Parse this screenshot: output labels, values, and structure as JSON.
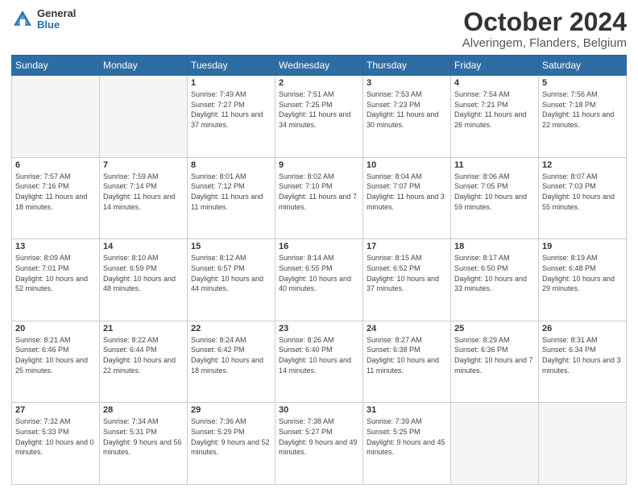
{
  "header": {
    "logo_line1": "General",
    "logo_line2": "Blue",
    "title": "October 2024",
    "subtitle": "Alveringem, Flanders, Belgium"
  },
  "days_of_week": [
    "Sunday",
    "Monday",
    "Tuesday",
    "Wednesday",
    "Thursday",
    "Friday",
    "Saturday"
  ],
  "weeks": [
    [
      {
        "day": "",
        "sunrise": "",
        "sunset": "",
        "daylight": "",
        "empty": true
      },
      {
        "day": "",
        "sunrise": "",
        "sunset": "",
        "daylight": "",
        "empty": true
      },
      {
        "day": "1",
        "sunrise": "Sunrise: 7:49 AM",
        "sunset": "Sunset: 7:27 PM",
        "daylight": "Daylight: 11 hours and 37 minutes.",
        "empty": false
      },
      {
        "day": "2",
        "sunrise": "Sunrise: 7:51 AM",
        "sunset": "Sunset: 7:25 PM",
        "daylight": "Daylight: 11 hours and 34 minutes.",
        "empty": false
      },
      {
        "day": "3",
        "sunrise": "Sunrise: 7:53 AM",
        "sunset": "Sunset: 7:23 PM",
        "daylight": "Daylight: 11 hours and 30 minutes.",
        "empty": false
      },
      {
        "day": "4",
        "sunrise": "Sunrise: 7:54 AM",
        "sunset": "Sunset: 7:21 PM",
        "daylight": "Daylight: 11 hours and 26 minutes.",
        "empty": false
      },
      {
        "day": "5",
        "sunrise": "Sunrise: 7:56 AM",
        "sunset": "Sunset: 7:18 PM",
        "daylight": "Daylight: 11 hours and 22 minutes.",
        "empty": false
      }
    ],
    [
      {
        "day": "6",
        "sunrise": "Sunrise: 7:57 AM",
        "sunset": "Sunset: 7:16 PM",
        "daylight": "Daylight: 11 hours and 18 minutes.",
        "empty": false
      },
      {
        "day": "7",
        "sunrise": "Sunrise: 7:59 AM",
        "sunset": "Sunset: 7:14 PM",
        "daylight": "Daylight: 11 hours and 14 minutes.",
        "empty": false
      },
      {
        "day": "8",
        "sunrise": "Sunrise: 8:01 AM",
        "sunset": "Sunset: 7:12 PM",
        "daylight": "Daylight: 11 hours and 11 minutes.",
        "empty": false
      },
      {
        "day": "9",
        "sunrise": "Sunrise: 8:02 AM",
        "sunset": "Sunset: 7:10 PM",
        "daylight": "Daylight: 11 hours and 7 minutes.",
        "empty": false
      },
      {
        "day": "10",
        "sunrise": "Sunrise: 8:04 AM",
        "sunset": "Sunset: 7:07 PM",
        "daylight": "Daylight: 11 hours and 3 minutes.",
        "empty": false
      },
      {
        "day": "11",
        "sunrise": "Sunrise: 8:06 AM",
        "sunset": "Sunset: 7:05 PM",
        "daylight": "Daylight: 10 hours and 59 minutes.",
        "empty": false
      },
      {
        "day": "12",
        "sunrise": "Sunrise: 8:07 AM",
        "sunset": "Sunset: 7:03 PM",
        "daylight": "Daylight: 10 hours and 55 minutes.",
        "empty": false
      }
    ],
    [
      {
        "day": "13",
        "sunrise": "Sunrise: 8:09 AM",
        "sunset": "Sunset: 7:01 PM",
        "daylight": "Daylight: 10 hours and 52 minutes.",
        "empty": false
      },
      {
        "day": "14",
        "sunrise": "Sunrise: 8:10 AM",
        "sunset": "Sunset: 6:59 PM",
        "daylight": "Daylight: 10 hours and 48 minutes.",
        "empty": false
      },
      {
        "day": "15",
        "sunrise": "Sunrise: 8:12 AM",
        "sunset": "Sunset: 6:57 PM",
        "daylight": "Daylight: 10 hours and 44 minutes.",
        "empty": false
      },
      {
        "day": "16",
        "sunrise": "Sunrise: 8:14 AM",
        "sunset": "Sunset: 6:55 PM",
        "daylight": "Daylight: 10 hours and 40 minutes.",
        "empty": false
      },
      {
        "day": "17",
        "sunrise": "Sunrise: 8:15 AM",
        "sunset": "Sunset: 6:52 PM",
        "daylight": "Daylight: 10 hours and 37 minutes.",
        "empty": false
      },
      {
        "day": "18",
        "sunrise": "Sunrise: 8:17 AM",
        "sunset": "Sunset: 6:50 PM",
        "daylight": "Daylight: 10 hours and 33 minutes.",
        "empty": false
      },
      {
        "day": "19",
        "sunrise": "Sunrise: 8:19 AM",
        "sunset": "Sunset: 6:48 PM",
        "daylight": "Daylight: 10 hours and 29 minutes.",
        "empty": false
      }
    ],
    [
      {
        "day": "20",
        "sunrise": "Sunrise: 8:21 AM",
        "sunset": "Sunset: 6:46 PM",
        "daylight": "Daylight: 10 hours and 25 minutes.",
        "empty": false
      },
      {
        "day": "21",
        "sunrise": "Sunrise: 8:22 AM",
        "sunset": "Sunset: 6:44 PM",
        "daylight": "Daylight: 10 hours and 22 minutes.",
        "empty": false
      },
      {
        "day": "22",
        "sunrise": "Sunrise: 8:24 AM",
        "sunset": "Sunset: 6:42 PM",
        "daylight": "Daylight: 10 hours and 18 minutes.",
        "empty": false
      },
      {
        "day": "23",
        "sunrise": "Sunrise: 8:26 AM",
        "sunset": "Sunset: 6:40 PM",
        "daylight": "Daylight: 10 hours and 14 minutes.",
        "empty": false
      },
      {
        "day": "24",
        "sunrise": "Sunrise: 8:27 AM",
        "sunset": "Sunset: 6:38 PM",
        "daylight": "Daylight: 10 hours and 11 minutes.",
        "empty": false
      },
      {
        "day": "25",
        "sunrise": "Sunrise: 8:29 AM",
        "sunset": "Sunset: 6:36 PM",
        "daylight": "Daylight: 10 hours and 7 minutes.",
        "empty": false
      },
      {
        "day": "26",
        "sunrise": "Sunrise: 8:31 AM",
        "sunset": "Sunset: 6:34 PM",
        "daylight": "Daylight: 10 hours and 3 minutes.",
        "empty": false
      }
    ],
    [
      {
        "day": "27",
        "sunrise": "Sunrise: 7:32 AM",
        "sunset": "Sunset: 5:33 PM",
        "daylight": "Daylight: 10 hours and 0 minutes.",
        "empty": false
      },
      {
        "day": "28",
        "sunrise": "Sunrise: 7:34 AM",
        "sunset": "Sunset: 5:31 PM",
        "daylight": "Daylight: 9 hours and 56 minutes.",
        "empty": false
      },
      {
        "day": "29",
        "sunrise": "Sunrise: 7:36 AM",
        "sunset": "Sunset: 5:29 PM",
        "daylight": "Daylight: 9 hours and 52 minutes.",
        "empty": false
      },
      {
        "day": "30",
        "sunrise": "Sunrise: 7:38 AM",
        "sunset": "Sunset: 5:27 PM",
        "daylight": "Daylight: 9 hours and 49 minutes.",
        "empty": false
      },
      {
        "day": "31",
        "sunrise": "Sunrise: 7:39 AM",
        "sunset": "Sunset: 5:25 PM",
        "daylight": "Daylight: 9 hours and 45 minutes.",
        "empty": false
      },
      {
        "day": "",
        "sunrise": "",
        "sunset": "",
        "daylight": "",
        "empty": true
      },
      {
        "day": "",
        "sunrise": "",
        "sunset": "",
        "daylight": "",
        "empty": true
      }
    ]
  ]
}
